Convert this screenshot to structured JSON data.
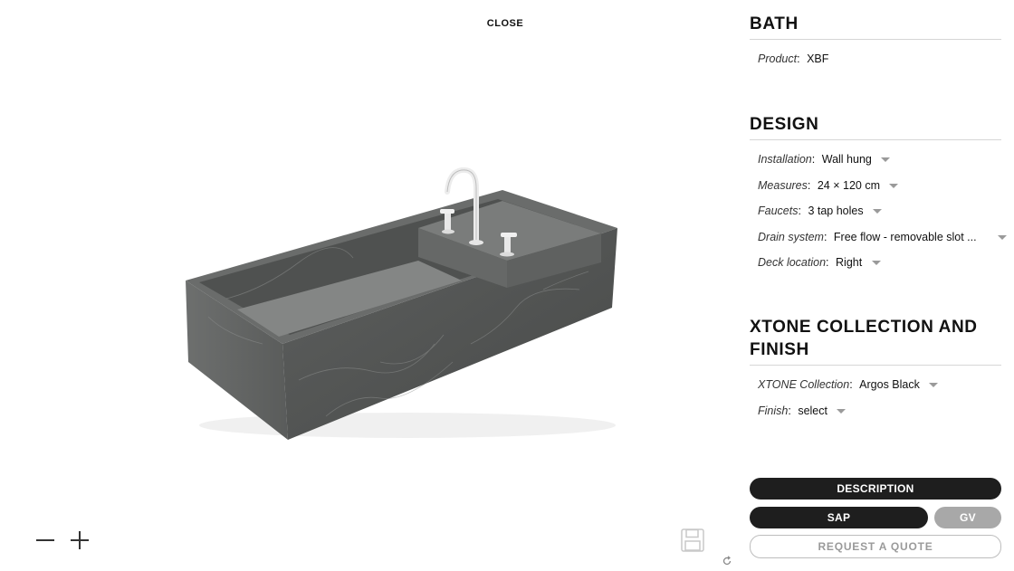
{
  "viewer": {
    "close_label": "CLOSE"
  },
  "bath": {
    "title": "BATH",
    "product_label": "Product",
    "product_value": "XBF"
  },
  "design": {
    "title": "DESIGN",
    "options": [
      {
        "label": "Installation",
        "value": "Wall hung"
      },
      {
        "label": "Measures",
        "value": "24 × 120 cm"
      },
      {
        "label": "Faucets",
        "value": "3 tap holes"
      },
      {
        "label": "Drain system",
        "value": "Free flow - removable slot ..."
      },
      {
        "label": "Deck location",
        "value": "Right"
      }
    ]
  },
  "xtone": {
    "title_line1": "XTONE COLLECTION AND",
    "title_line2": "FINISH",
    "options": [
      {
        "label": "XTONE Collection",
        "value": "Argos Black"
      },
      {
        "label": "Finish",
        "value": "select"
      }
    ]
  },
  "actions": {
    "description_label": "DESCRIPTION",
    "sap_label": "SAP",
    "gv_label": "GV",
    "quote_label": "REQUEST A QUOTE"
  },
  "icons": {
    "zoom_out": "minus-icon",
    "zoom_in": "plus-icon",
    "save": "floppy-disk-icon",
    "refresh": "refresh-icon",
    "dropdown": "caret-down-icon"
  },
  "colors": {
    "dark_button": "#1e1e1e",
    "grey_button": "#a8a8a8",
    "stone": "#5b5d5c"
  }
}
